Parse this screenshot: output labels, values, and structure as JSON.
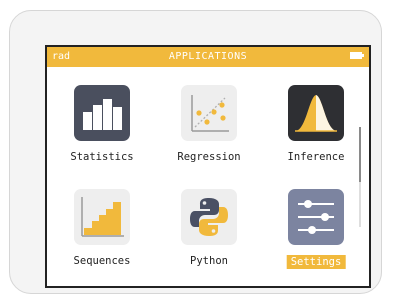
{
  "status_bar": {
    "mode": "rad",
    "title": "APPLICATIONS"
  },
  "apps": [
    {
      "label": "Statistics",
      "icon": "bar-chart-icon"
    },
    {
      "label": "Regression",
      "icon": "scatter-plot-icon"
    },
    {
      "label": "Inference",
      "icon": "bell-curve-icon"
    },
    {
      "label": "Sequences",
      "icon": "staircase-chart-icon"
    },
    {
      "label": "Python",
      "icon": "python-logo-icon"
    },
    {
      "label": "Settings",
      "icon": "sliders-icon",
      "selected": true
    }
  ],
  "colors": {
    "accent": "#f1b93c",
    "dark_icon": "#4a4f5e",
    "settings_icon": "#7c84a0"
  }
}
